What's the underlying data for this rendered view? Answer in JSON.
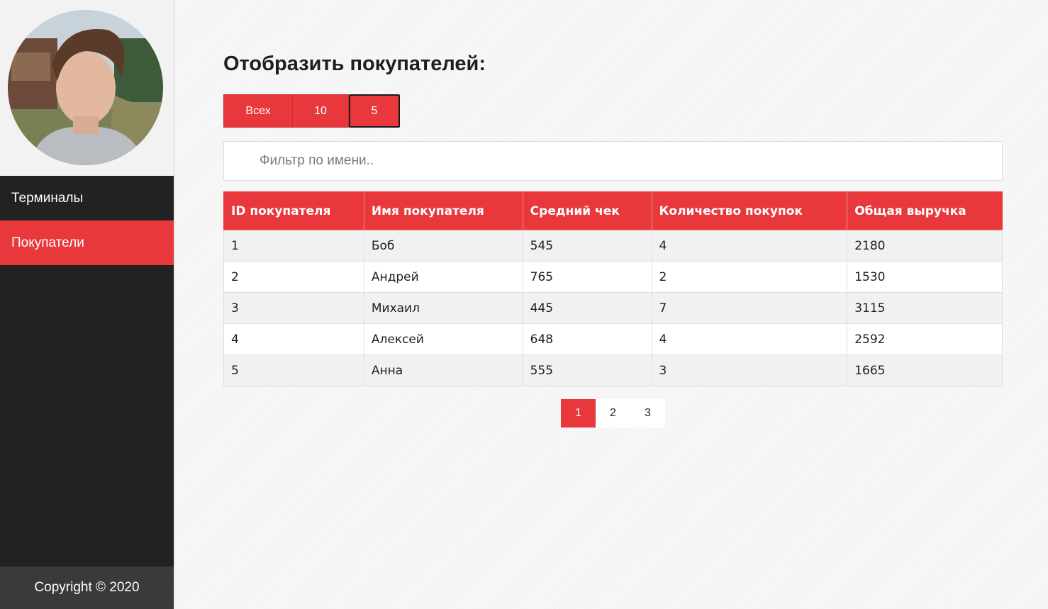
{
  "sidebar": {
    "items": [
      {
        "label": "Терминалы",
        "active": false
      },
      {
        "label": "Покупатели",
        "active": true
      }
    ],
    "copyright": "Copyright © 2020"
  },
  "main": {
    "title": "Отобразить покупателей:",
    "page_size_buttons": [
      {
        "label": "Всех"
      },
      {
        "label": "10"
      },
      {
        "label": "5",
        "selected": true
      }
    ],
    "filter": {
      "placeholder": "Фильтр по имени..",
      "value": ""
    },
    "table": {
      "columns": [
        "ID покупателя",
        "Имя покупателя",
        "Средний чек",
        "Количество покупок",
        "Общая выручка"
      ],
      "rows": [
        [
          "1",
          "Боб",
          "545",
          "4",
          "2180"
        ],
        [
          "2",
          "Андрей",
          "765",
          "2",
          "1530"
        ],
        [
          "3",
          "Михаил",
          "445",
          "7",
          "3115"
        ],
        [
          "4",
          "Алексей",
          "648",
          "4",
          "2592"
        ],
        [
          "5",
          "Анна",
          "555",
          "3",
          "1665"
        ]
      ]
    },
    "pagination": {
      "pages": [
        "1",
        "2",
        "3"
      ],
      "current": "1"
    }
  },
  "colors": {
    "accent": "#e8383c",
    "sidebar_bg": "#222222",
    "footer_bg": "#3a3a3a"
  }
}
